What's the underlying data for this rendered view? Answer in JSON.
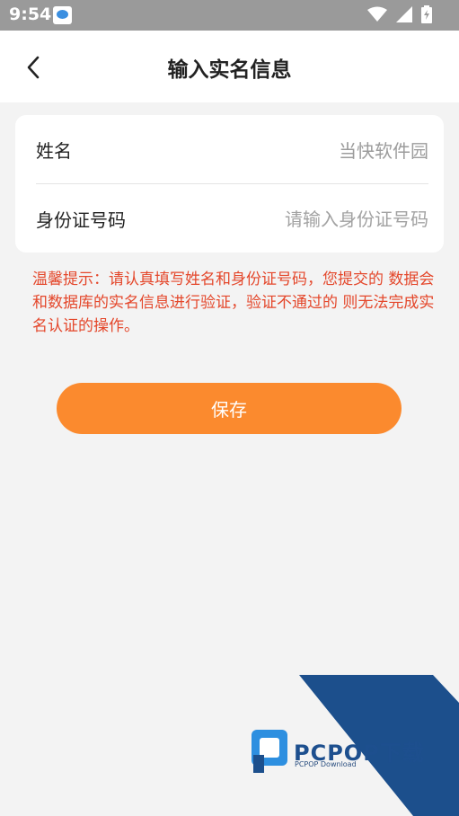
{
  "status_bar": {
    "time": "9:54",
    "icons": [
      "app-notification-icon",
      "wifi-icon",
      "signal-icon",
      "battery-icon"
    ]
  },
  "header": {
    "back_icon": "chevron-left-icon",
    "title": "输入实名信息"
  },
  "form": {
    "name_field": {
      "label": "姓名",
      "value": "当快软件园"
    },
    "id_field": {
      "label": "身份证号码",
      "placeholder": "请输入身份证号码"
    }
  },
  "tip": "温馨提示：请认真填写姓名和身份证号码，您提交的 数据会和数据库的实名信息进行验证，验证不通过的 则无法完成实名认证的操作。",
  "actions": {
    "save_label": "保存"
  },
  "watermark": {
    "brand": "PCPOP下载",
    "sub": "PCPOP Download"
  },
  "colors": {
    "accent": "#fb8a2e",
    "tip": "#e4472b",
    "status_bar": "#9a9a9a",
    "watermark": "#1d4f8e"
  }
}
